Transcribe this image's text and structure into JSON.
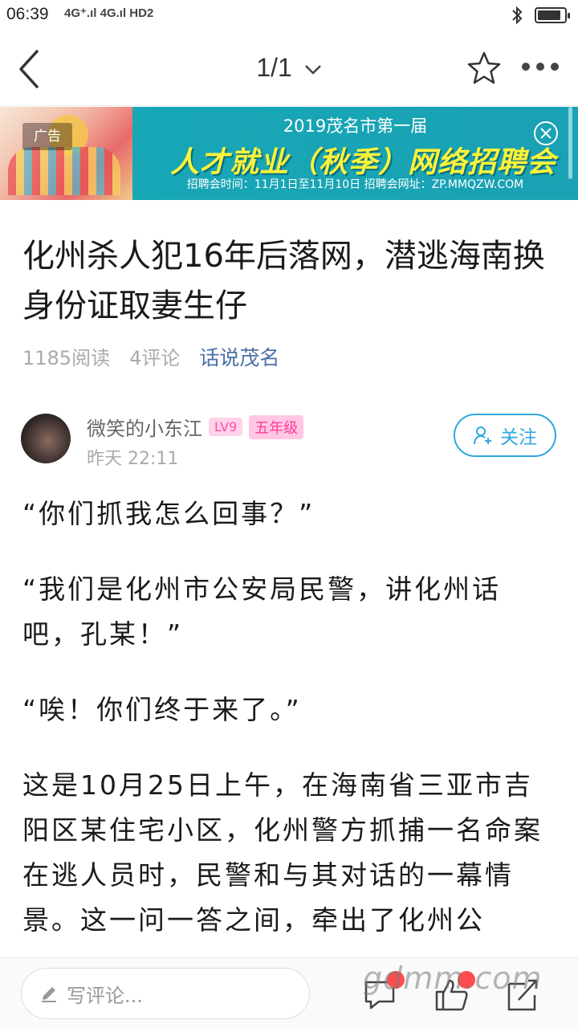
{
  "status_bar": {
    "time": "06:39",
    "signal_text": "4G⁺.ıl 4G.ıl HD2",
    "battery_level": 0.9
  },
  "nav": {
    "title": "1/1",
    "back_icon": "back-arrow-icon",
    "star_icon": "star-icon",
    "more_icon": "more-dots-icon"
  },
  "ad": {
    "tag": "广告",
    "line1": "2019茂名市第一届",
    "line2": "人才就业（秋季）网络招聘会",
    "line3": "招聘会时间：11月1日至11月10日    招聘会网址：ZP.MMQZW.COM"
  },
  "article": {
    "title": "化州杀人犯16年后落网，潜逃海南换身份证取妻生仔",
    "reads": "1185阅读",
    "comments": "4评论",
    "forum": "话说茂名"
  },
  "author": {
    "name": "微笑的小东江",
    "level": "LV9",
    "grade": "五年级",
    "time": "昨天 22:11",
    "follow_label": "关注"
  },
  "body": {
    "p1": "“你们抓我怎么回事？”",
    "p2": "“我们是化州市公安局民警，讲化州话吧，孔某！”",
    "p3": "“唉！你们终于来了。”",
    "p4": "这是10月25日上午，在海南省三亚市吉阳区某住宅小区，化州警方抓捕一名命案在逃人员时，民警和与其对话的一幕情景。这一问一答之间，牵出了化州公"
  },
  "bottom": {
    "comment_placeholder": "写评论...",
    "watermark": "gdmm.com"
  },
  "colors": {
    "accent": "#2ea8e0",
    "forum_link": "#4a6fa5",
    "badge_pink": "#ff4fa6"
  }
}
